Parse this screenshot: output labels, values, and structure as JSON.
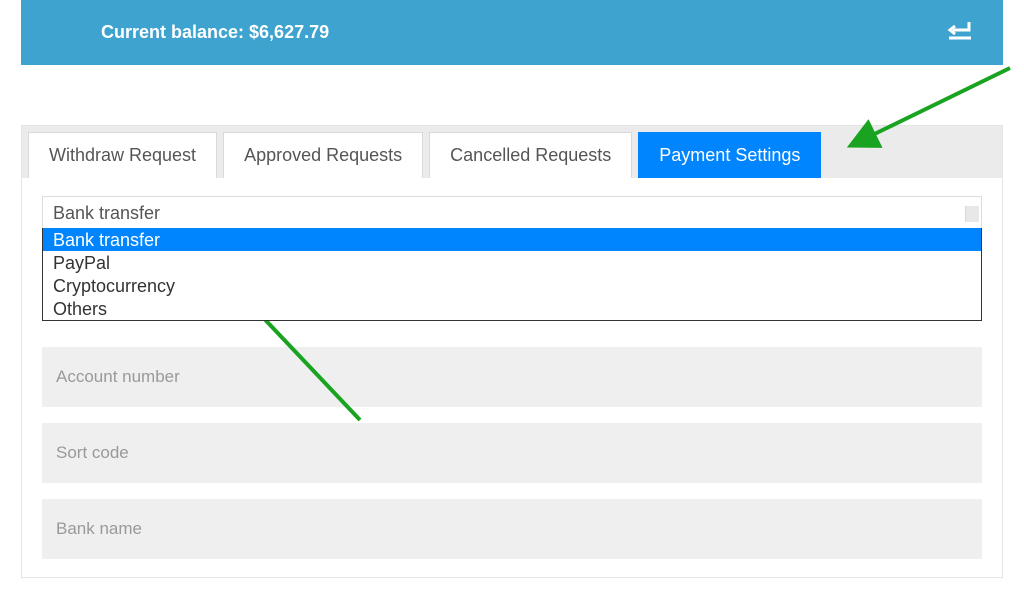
{
  "balance": {
    "label": "Current balance: $6,627.79"
  },
  "tabs": [
    {
      "label": "Withdraw Request",
      "active": false
    },
    {
      "label": "Approved Requests",
      "active": false
    },
    {
      "label": "Cancelled Requests",
      "active": false
    },
    {
      "label": "Payment Settings",
      "active": true
    }
  ],
  "payment": {
    "selected": "Bank transfer",
    "options": [
      "Bank transfer",
      "PayPal",
      "Cryptocurrency",
      "Others"
    ]
  },
  "fields": {
    "account_number": "Account number",
    "sort_code": "Sort code",
    "bank_name": "Bank name"
  },
  "annotations": {
    "arrow_to_tab": true,
    "arrow_to_dropdown": true
  },
  "colors": {
    "accent_blue": "#0085ff",
    "header_blue": "#3fa3d0",
    "arrow_green": "#1aa321"
  }
}
